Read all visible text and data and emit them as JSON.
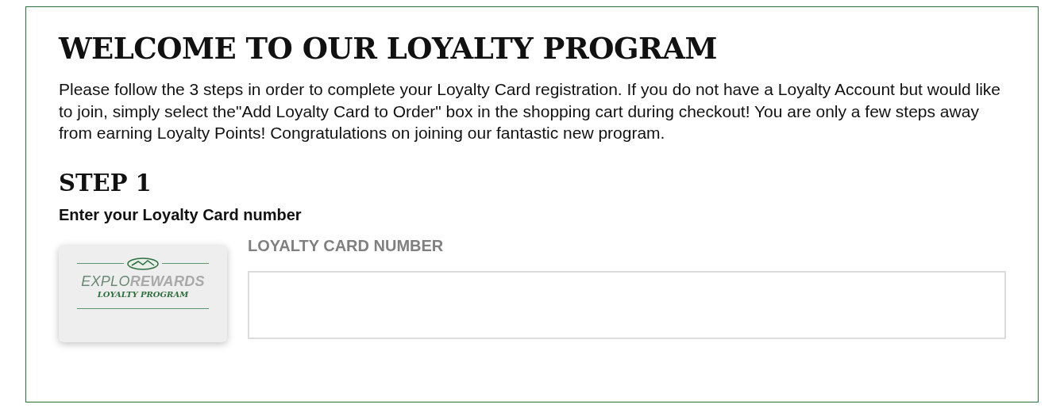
{
  "title": "WELCOME TO OUR LOYALTY PROGRAM",
  "intro": "Please follow the 3 steps in order to complete your Loyalty Card registration. If you do not have a Loyalty Account but would like to join, simply select the\"Add Loyalty Card to Order\" box in the shopping cart during checkout! You are only a few steps away from earning Loyalty Points! Congratulations on joining our fantastic new program.",
  "step": {
    "heading": "STEP 1",
    "instruction": "Enter your Loyalty Card number",
    "card": {
      "brand_light": "EXPLO",
      "brand_bold": "REWARDS",
      "subtitle": "LOYALTY PROGRAM"
    },
    "field": {
      "label": "LOYALTY CARD NUMBER"
    }
  }
}
